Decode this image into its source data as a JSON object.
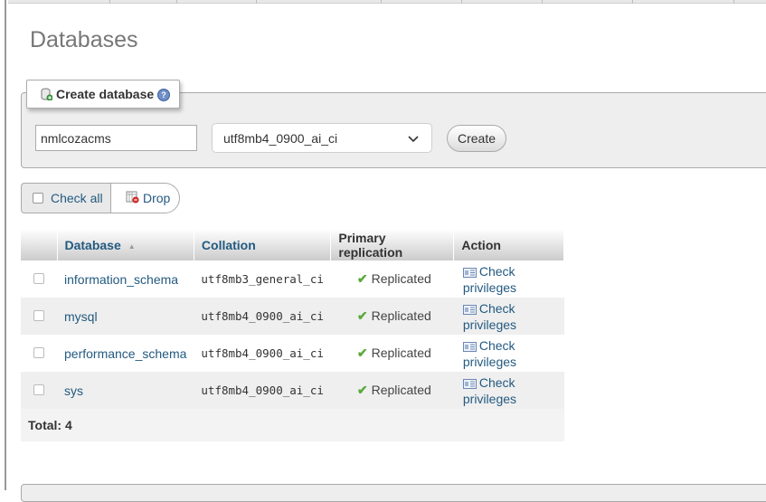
{
  "page": {
    "title": "Databases"
  },
  "create": {
    "legend": "Create database",
    "db_name_value": "nmlcozacms",
    "collation_selected": "utf8mb4_0900_ai_ci",
    "create_label": "Create",
    "legend_icon": "database-add-icon",
    "help_icon": "help-icon"
  },
  "actions": {
    "check_all_label": "Check all",
    "drop_label": "Drop"
  },
  "table": {
    "headers": {
      "database": "Database",
      "collation": "Collation",
      "replication": "Primary replication",
      "action": "Action"
    },
    "rows": [
      {
        "name": "information_schema",
        "collation": "utf8mb3_general_ci",
        "replication": "Replicated",
        "action": "Check privileges"
      },
      {
        "name": "mysql",
        "collation": "utf8mb4_0900_ai_ci",
        "replication": "Replicated",
        "action": "Check privileges"
      },
      {
        "name": "performance_schema",
        "collation": "utf8mb4_0900_ai_ci",
        "replication": "Replicated",
        "action": "Check privileges"
      },
      {
        "name": "sys",
        "collation": "utf8mb4_0900_ai_ci",
        "replication": "Replicated",
        "action": "Check privileges"
      }
    ],
    "total": "Total: 4"
  },
  "colors": {
    "link": "#235a81",
    "replicated_check": "#5ca93a"
  }
}
